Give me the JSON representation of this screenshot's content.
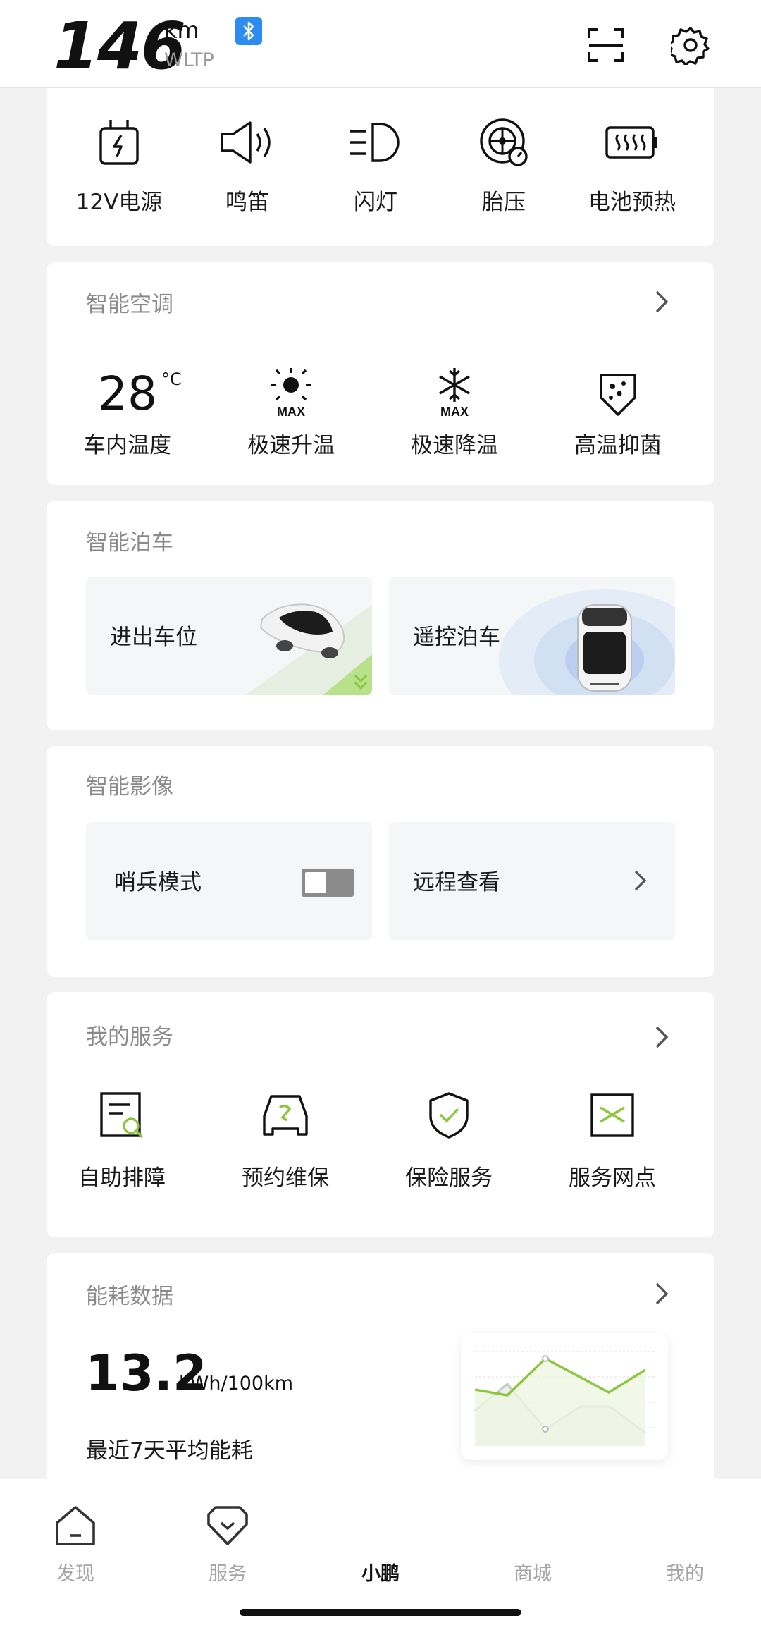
{
  "header": {
    "range_value": "146",
    "range_unit": "km",
    "range_standard": "WLTP",
    "bluetooth_icon": "bluetooth-icon",
    "scan_icon": "scan-icon",
    "settings_icon": "gear-icon"
  },
  "quick_controls": {
    "items": [
      {
        "label": "12V电源",
        "icon": "plug-lightning-icon"
      },
      {
        "label": "鸣笛",
        "icon": "horn-speaker-icon"
      },
      {
        "label": "闪灯",
        "icon": "headlight-icon"
      },
      {
        "label": "胎压",
        "icon": "tire-pressure-icon"
      },
      {
        "label": "电池预热",
        "icon": "battery-heat-icon"
      }
    ]
  },
  "smart_ac": {
    "title": "智能空调",
    "temperature": "28",
    "temperature_unit": "°C",
    "items": [
      {
        "label": "车内温度"
      },
      {
        "label": "极速升温",
        "icon": "sun-max-icon"
      },
      {
        "label": "极速降温",
        "icon": "snowflake-max-icon"
      },
      {
        "label": "高温抑菌",
        "icon": "shield-sterilize-icon"
      }
    ],
    "max_text": "MAX"
  },
  "smart_parking": {
    "title": "智能泊车",
    "tiles": [
      {
        "label": "进出车位"
      },
      {
        "label": "遥控泊车"
      }
    ]
  },
  "smart_camera": {
    "title": "智能影像",
    "sentry_label": "哨兵模式",
    "sentry_on": false,
    "remote_view_label": "远程查看"
  },
  "my_services": {
    "title": "我的服务",
    "items": [
      {
        "label": "自助排障",
        "icon": "diagnose-doc-icon"
      },
      {
        "label": "预约维保",
        "icon": "car-wrench-icon"
      },
      {
        "label": "保险服务",
        "icon": "shield-check-icon"
      },
      {
        "label": "服务网点",
        "icon": "service-point-icon"
      }
    ]
  },
  "energy": {
    "title": "能耗数据",
    "value": "13.2",
    "unit": "kWh/100km",
    "description": "最近7天平均能耗"
  },
  "nav": {
    "items": [
      {
        "label": "发现",
        "icon": "home-icon",
        "active": false
      },
      {
        "label": "服务",
        "icon": "service-badge-icon",
        "active": false
      },
      {
        "label": "小鹏",
        "icon": "",
        "active": true
      },
      {
        "label": "商城",
        "icon": "",
        "active": false
      },
      {
        "label": "我的",
        "icon": "",
        "active": false
      }
    ]
  },
  "colors": {
    "accent_green": "#8cc63f",
    "bluetooth_blue": "#2d8cf0",
    "muted_text": "#8a8a8a"
  }
}
